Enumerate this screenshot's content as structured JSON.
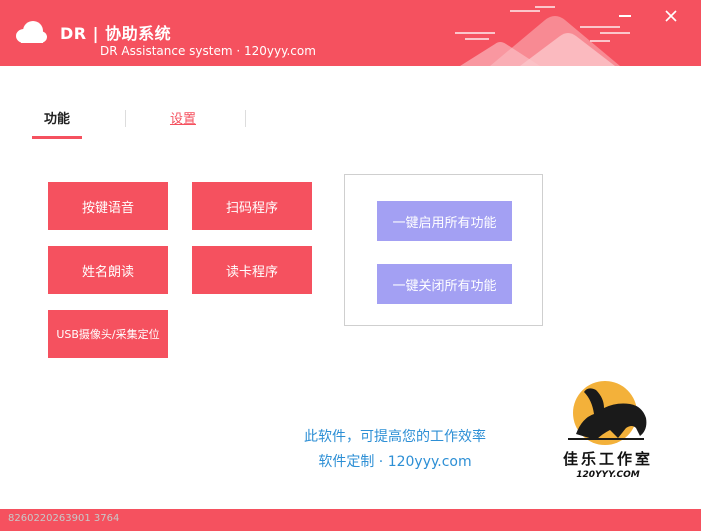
{
  "header": {
    "title": "DR | 协助系统",
    "subtitle": "DR Assistance system · 120yyy.com",
    "minimize_icon": "minimize-icon",
    "close_icon": "close-icon"
  },
  "tabs": [
    {
      "label": "功能",
      "active": true
    },
    {
      "label": "设置",
      "active": false
    }
  ],
  "functions": [
    {
      "label": "按键语音"
    },
    {
      "label": "扫码程序"
    },
    {
      "label": "姓名朗读"
    },
    {
      "label": "读卡程序"
    },
    {
      "label": "USB摄像头/采集定位"
    }
  ],
  "panel": {
    "enable_all": "一键启用所有功能",
    "disable_all": "一键关闭所有功能"
  },
  "promo": {
    "line1": "此软件，可提高您的工作效率",
    "line2": "软件定制 · 120yyy.com"
  },
  "brand": {
    "name": "佳乐工作室",
    "url": "120YYY.COM"
  },
  "footer": {
    "machine_id": "8260220263901 3764"
  },
  "colors": {
    "accent": "#f5515f",
    "panel_button": "#a3a0f3",
    "promo_text": "#2d8fd5"
  }
}
